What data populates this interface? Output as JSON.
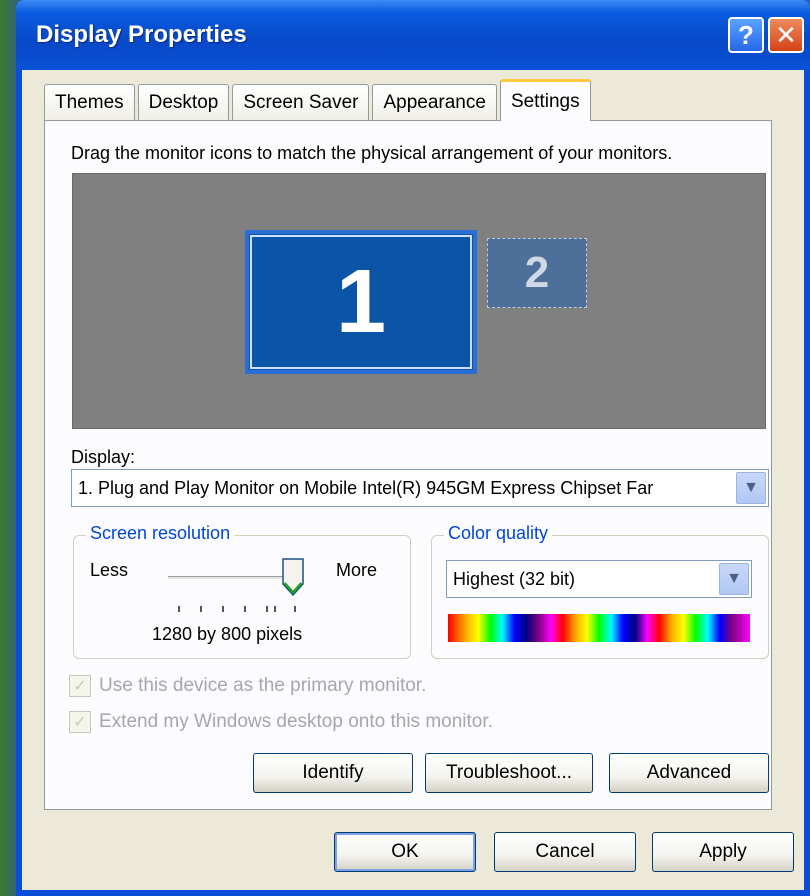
{
  "window": {
    "title": "Display Properties"
  },
  "titlebar": {
    "help_glyph": "?",
    "close_glyph": "✕"
  },
  "tabs": [
    {
      "label": "Themes",
      "active": false
    },
    {
      "label": "Desktop",
      "active": false
    },
    {
      "label": "Screen Saver",
      "active": false
    },
    {
      "label": "Appearance",
      "active": false
    },
    {
      "label": "Settings",
      "active": true
    }
  ],
  "settings": {
    "instruction": "Drag the monitor icons to match the physical arrangement of your monitors.",
    "monitor1_label": "1",
    "monitor2_label": "2",
    "display_label": "Display:",
    "display_value": "1. Plug and Play Monitor on Mobile Intel(R) 945GM Express Chipset Far",
    "resolution": {
      "group_title": "Screen resolution",
      "less_label": "Less",
      "more_label": "More",
      "value_text": "1280 by 800 pixels",
      "slider_position": 1.0
    },
    "color": {
      "group_title": "Color quality",
      "selected": "Highest (32 bit)"
    },
    "checkboxes": [
      {
        "label": "Use this device as the primary monitor.",
        "checked": true,
        "enabled": false
      },
      {
        "label": "Extend my Windows desktop onto this monitor.",
        "checked": true,
        "enabled": false
      }
    ],
    "buttons": {
      "identify": "Identify",
      "troubleshoot": "Troubleshoot...",
      "advanced": "Advanced"
    }
  },
  "footer": {
    "ok": "OK",
    "cancel": "Cancel",
    "apply": "Apply"
  },
  "colors": {
    "titlebar": "#0848c8",
    "monitor_area": "#808080",
    "monitor1": "#0b55a8",
    "group_title": "#0046d5"
  }
}
